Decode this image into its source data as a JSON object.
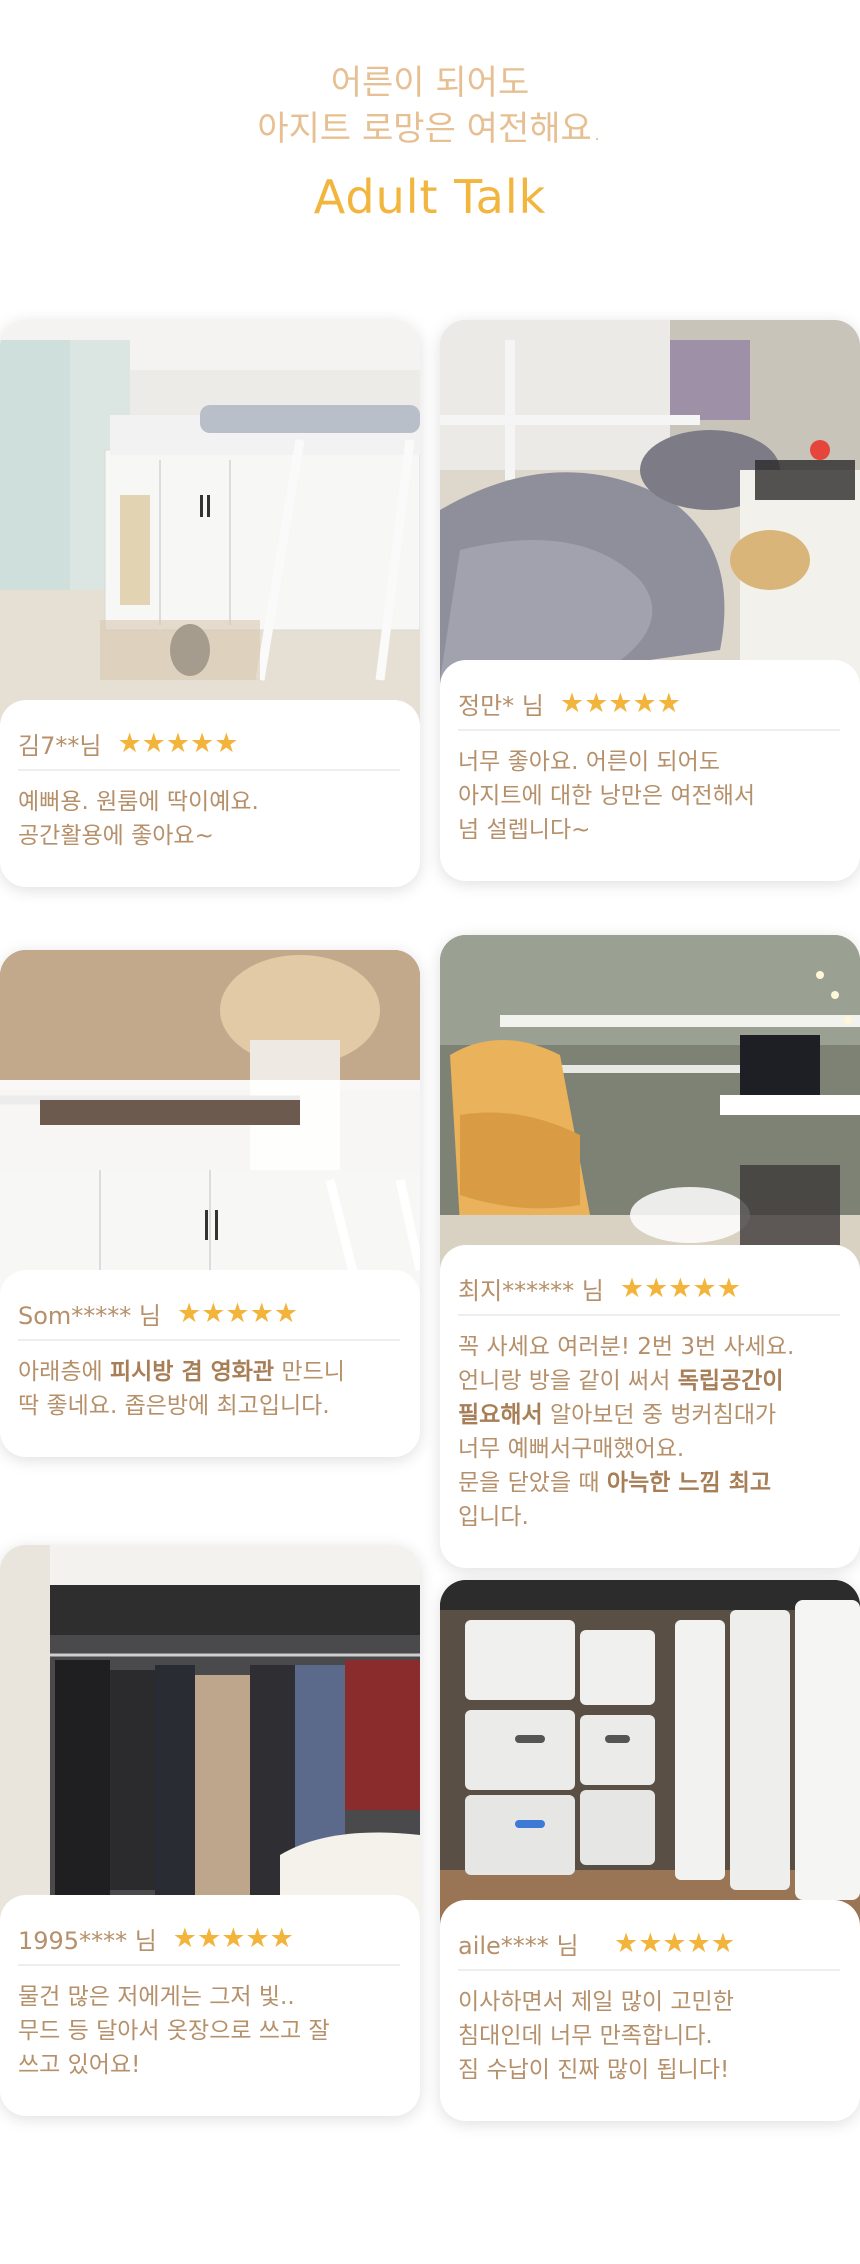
{
  "hero": {
    "line1": "어른이 되어도",
    "line2": "아지트 로망은 여전해요.",
    "subtitle": "Adult Talk"
  },
  "colors": {
    "accent": "#f2b53d",
    "text": "#b5906a",
    "star": "#f2b43a"
  },
  "reviews": [
    {
      "reviewer": "김7**님",
      "stars": "★★★★★",
      "lines": [
        "예뻐용. 원룸에 딱이예요.",
        "공간활용에 좋아요~"
      ]
    },
    {
      "reviewer": "정만* 님",
      "stars": "★★★★★",
      "lines": [
        "너무 좋아요. 어른이 되어도",
        "아지트에 대한 낭만은 여전해서",
        "넘 설렙니다~"
      ]
    },
    {
      "reviewer": "Som***** 님",
      "stars": "★★★★★",
      "l1_pre": "아래층에 ",
      "l1_bold": "피시방 겸 영화관",
      "l1_post": " 만드니",
      "l2": "딱 좋네요. 좁은방에 최고입니다."
    },
    {
      "reviewer": "최지****** 님",
      "stars": "★★★★★",
      "l1": "꼭 사세요 여러분! 2번 3번 사세요.",
      "l2_pre": "언니랑 방을 같이 써서 ",
      "l2_bold": "독립공간이",
      "l3_bold": "필요해서",
      "l3_post": " 알아보던 중 벙커침대가",
      "l4": "너무 예뻐서구매했어요.",
      "l5_pre": "문을 닫았을 때 ",
      "l5_bold": "아늑한 느낌 최고",
      "l6": "입니다."
    },
    {
      "reviewer": "1995**** 님",
      "stars": "★★★★★",
      "lines": [
        "물건 많은 저에게는 그저 빛..",
        "무드 등 달아서 옷장으로 쓰고 잘",
        "쓰고 있어요!"
      ]
    },
    {
      "reviewer": "aile**** 님",
      "stars": "★★★★★",
      "lines": [
        "이사하면서 제일 많이 고민한",
        "침대인데 너무 만족합니다.",
        "짐 수납이 진짜 많이 됩니다!"
      ]
    }
  ]
}
